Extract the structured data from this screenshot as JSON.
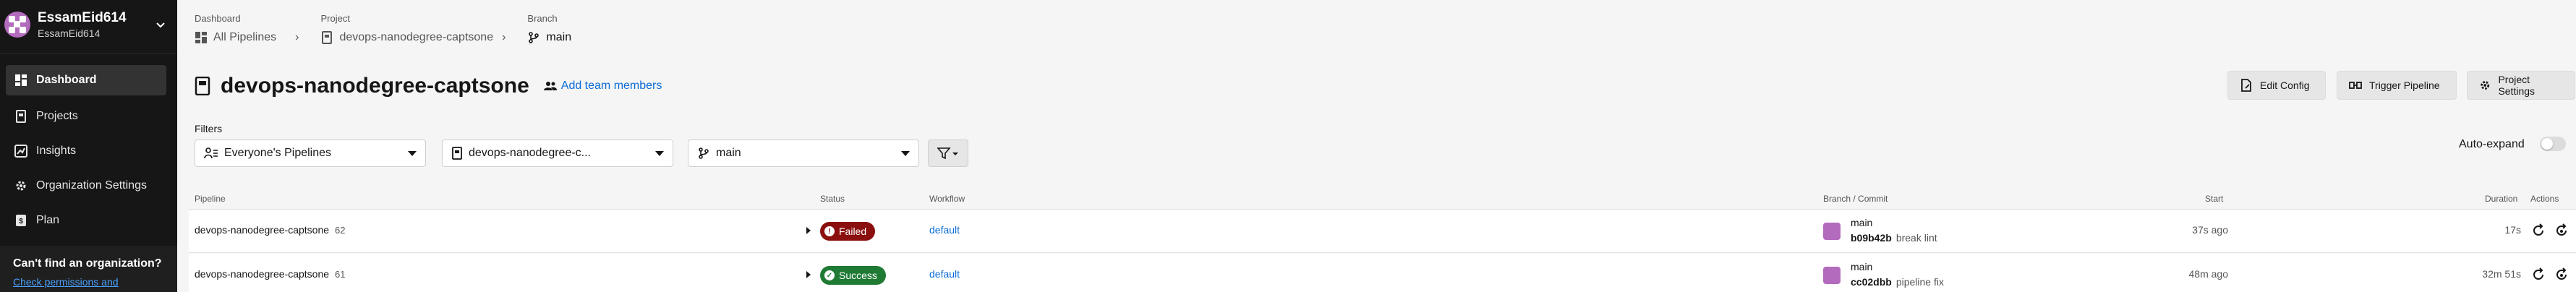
{
  "org": {
    "name": "EssamEid614",
    "subname": "EssamEid614"
  },
  "nav": {
    "items": [
      {
        "label": "Dashboard",
        "icon": "dashboard-icon",
        "active": true
      },
      {
        "label": "Projects",
        "icon": "projects-icon",
        "active": false
      },
      {
        "label": "Insights",
        "icon": "insights-icon",
        "active": false
      },
      {
        "label": "Organization Settings",
        "icon": "gear-icon",
        "active": false
      },
      {
        "label": "Plan",
        "icon": "plan-icon",
        "active": false
      }
    ]
  },
  "callout": {
    "title": "Can't find an organization?",
    "link": "Check permissions and"
  },
  "breadcrumbs": [
    {
      "label": "Dashboard",
      "value": "All Pipelines",
      "icon": "dashboard-icon"
    },
    {
      "label": "Project",
      "value": "devops-nanodegree-captsone",
      "icon": "project-icon"
    },
    {
      "label": "Branch",
      "value": "main",
      "icon": "branch-icon"
    }
  ],
  "page": {
    "title": "devops-nanodegree-captsone",
    "team_link": "Add team members"
  },
  "buttons": {
    "edit_config": "Edit Config",
    "trigger_pipeline": "Trigger Pipeline",
    "project_settings": "Project Settings"
  },
  "filters": {
    "label": "Filters",
    "pipelines": "Everyone's Pipelines",
    "project": "devops-nanodegree-c...",
    "branch": "main"
  },
  "auto_expand": {
    "label": "Auto-expand",
    "on": false
  },
  "table": {
    "headers": {
      "pipeline": "Pipeline",
      "status": "Status",
      "workflow": "Workflow",
      "branch_commit": "Branch / Commit",
      "start": "Start",
      "duration": "Duration",
      "actions": "Actions"
    },
    "rows": [
      {
        "pipeline": "devops-nanodegree-captsone",
        "number": "62",
        "status": "Failed",
        "status_color": "#8b0f0f",
        "workflow": "default",
        "branch": "main",
        "commit_hash": "b09b42b",
        "commit_msg": "break lint",
        "start": "37s ago",
        "duration": "17s"
      },
      {
        "pipeline": "devops-nanodegree-captsone",
        "number": "61",
        "status": "Success",
        "status_color": "#1f7a34",
        "workflow": "default",
        "branch": "main",
        "commit_hash": "cc02dbb",
        "commit_msg": "pipeline fix",
        "start": "48m ago",
        "duration": "32m 51s"
      }
    ]
  },
  "colors": {
    "sidebar_bg": "#161616",
    "link": "#0a6cd6",
    "accent_avatar": "#b36bbd"
  }
}
